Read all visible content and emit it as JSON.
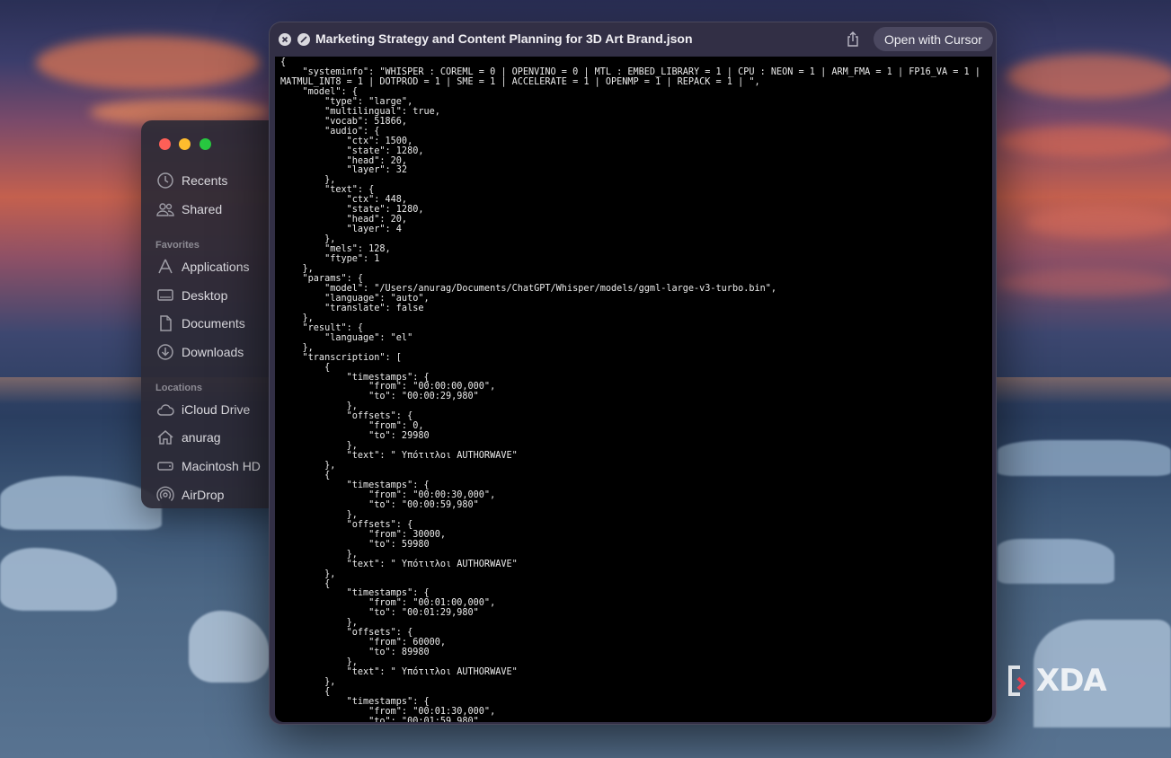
{
  "finder": {
    "sections": {
      "favorites": "Favorites",
      "locations": "Locations"
    },
    "items": [
      {
        "label": "Recents",
        "icon": "clock-icon"
      },
      {
        "label": "Shared",
        "icon": "shared-people-icon"
      },
      {
        "label": "Applications",
        "icon": "applications-icon"
      },
      {
        "label": "Desktop",
        "icon": "desktop-icon"
      },
      {
        "label": "Documents",
        "icon": "document-icon"
      },
      {
        "label": "Downloads",
        "icon": "download-icon"
      },
      {
        "label": "iCloud Drive",
        "icon": "cloud-icon"
      },
      {
        "label": "anurag",
        "icon": "home-icon"
      },
      {
        "label": "Macintosh HD",
        "icon": "disk-icon"
      },
      {
        "label": "AirDrop",
        "icon": "airdrop-icon"
      }
    ]
  },
  "quicklook": {
    "title": "Marketing Strategy and Content Planning for 3D Art Brand.json",
    "open_button": "Open with Cursor",
    "content_lines": [
      "{",
      "    \"systeminfo\": \"WHISPER : COREML = 0 | OPENVINO = 0 | MTL : EMBED_LIBRARY = 1 | CPU : NEON = 1 | ARM_FMA = 1 | FP16_VA = 1 |",
      "MATMUL_INT8 = 1 | DOTPROD = 1 | SME = 1 | ACCELERATE = 1 | OPENMP = 1 | REPACK = 1 | \",",
      "    \"model\": {",
      "        \"type\": \"large\",",
      "        \"multilingual\": true,",
      "        \"vocab\": 51866,",
      "        \"audio\": {",
      "            \"ctx\": 1500,",
      "            \"state\": 1280,",
      "            \"head\": 20,",
      "            \"layer\": 32",
      "        },",
      "        \"text\": {",
      "            \"ctx\": 448,",
      "            \"state\": 1280,",
      "            \"head\": 20,",
      "            \"layer\": 4",
      "        },",
      "        \"mels\": 128,",
      "        \"ftype\": 1",
      "    },",
      "    \"params\": {",
      "        \"model\": \"/Users/anurag/Documents/ChatGPT/Whisper/models/ggml-large-v3-turbo.bin\",",
      "        \"language\": \"auto\",",
      "        \"translate\": false",
      "    },",
      "    \"result\": {",
      "        \"language\": \"el\"",
      "    },",
      "    \"transcription\": [",
      "        {",
      "            \"timestamps\": {",
      "                \"from\": \"00:00:00,000\",",
      "                \"to\": \"00:00:29,980\"",
      "            },",
      "            \"offsets\": {",
      "                \"from\": 0,",
      "                \"to\": 29980",
      "            },",
      "            \"text\": \" Υπότιτλοι AUTHORWAVE\"",
      "        },",
      "        {",
      "            \"timestamps\": {",
      "                \"from\": \"00:00:30,000\",",
      "                \"to\": \"00:00:59,980\"",
      "            },",
      "            \"offsets\": {",
      "                \"from\": 30000,",
      "                \"to\": 59980",
      "            },",
      "            \"text\": \" Υπότιτλοι AUTHORWAVE\"",
      "        },",
      "        {",
      "            \"timestamps\": {",
      "                \"from\": \"00:01:00,000\",",
      "                \"to\": \"00:01:29,980\"",
      "            },",
      "            \"offsets\": {",
      "                \"from\": 60000,",
      "                \"to\": 89980",
      "            },",
      "            \"text\": \" Υπότιτλοι AUTHORWAVE\"",
      "        },",
      "        {",
      "            \"timestamps\": {",
      "                \"from\": \"00:01:30,000\",",
      "                \"to\": \"00:01:59,980\""
    ]
  },
  "watermark": {
    "text": "XDA",
    "accent": "#e8414f"
  },
  "colors": {
    "close_red": "#fe5f57",
    "minimize_yellow": "#febc2e",
    "zoom_green": "#28c840"
  }
}
